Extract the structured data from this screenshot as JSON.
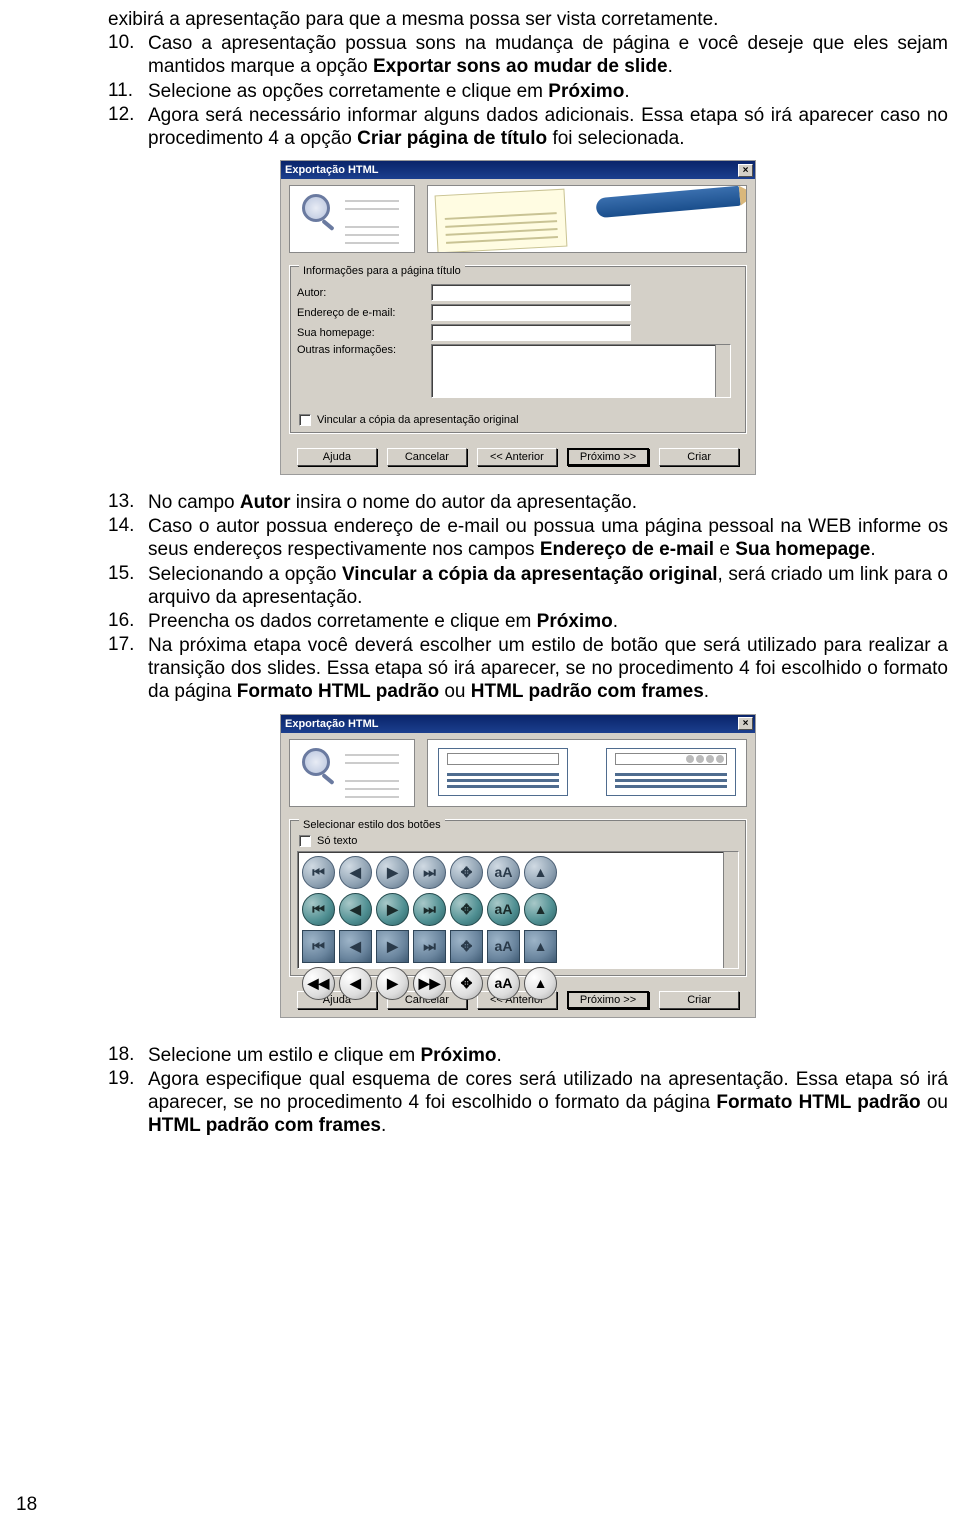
{
  "intro_line": "exibirá a apresentação para que a mesma possa ser vista corretamente.",
  "items_a": [
    {
      "n": "10.",
      "pre": "Caso a apresentação possua sons na mudança de página e você deseje que eles sejam mantidos marque a opção ",
      "b": "Exportar sons ao mudar de slide",
      "post": "."
    },
    {
      "n": "11.",
      "pre": "Selecione as opções corretamente e clique em ",
      "b": "Próximo",
      "post": "."
    },
    {
      "n": "12.",
      "pre": "Agora será necessário informar alguns dados adicionais. Essa etapa só irá aparecer caso no procedimento 4 a opção ",
      "b": "Criar página de título",
      "post": " foi selecionada."
    }
  ],
  "dialog1": {
    "title": "Exportação HTML",
    "close": "×",
    "group": "Informações para a página título",
    "labels": {
      "autor": "Autor:",
      "email": "Endereço de e-mail:",
      "home": "Sua homepage:",
      "other": "Outras informações:"
    },
    "chk": "Vincular a cópia da apresentação original",
    "buttons": {
      "ajuda": "Ajuda",
      "cancelar": "Cancelar",
      "anterior": "<< Anterior",
      "proximo": "Próximo >>",
      "criar": "Criar"
    }
  },
  "items_b": [
    {
      "n": "13.",
      "parts": [
        {
          "t": "No campo "
        },
        {
          "t": "Autor",
          "b": true
        },
        {
          "t": " insira o nome do autor da apresentação."
        }
      ]
    },
    {
      "n": "14.",
      "parts": [
        {
          "t": "Caso o autor possua endereço de e-mail ou possua uma página pessoal na WEB informe os seus endereços respectivamente nos campos "
        },
        {
          "t": "Endereço de e-mail",
          "b": true
        },
        {
          "t": " e "
        },
        {
          "t": "Sua homepage",
          "b": true
        },
        {
          "t": "."
        }
      ]
    },
    {
      "n": "15.",
      "parts": [
        {
          "t": "Selecionando a opção "
        },
        {
          "t": "Vincular a cópia da apresentação original",
          "b": true
        },
        {
          "t": ", será criado um link para o arquivo da apresentação."
        }
      ]
    },
    {
      "n": "16.",
      "parts": [
        {
          "t": "Preencha os dados corretamente e clique em "
        },
        {
          "t": "Próximo",
          "b": true
        },
        {
          "t": "."
        }
      ]
    },
    {
      "n": "17.",
      "parts": [
        {
          "t": "Na próxima etapa você deverá escolher um estilo de botão que será utilizado para realizar a transição dos slides. Essa etapa só irá aparecer, se no procedimento 4 foi escolhido o formato da página "
        },
        {
          "t": "Formato HTML padrão",
          "b": true
        },
        {
          "t": " ou "
        },
        {
          "t": "HTML padrão com frames",
          "b": true
        },
        {
          "t": "."
        }
      ]
    }
  ],
  "dialog2": {
    "title": "Exportação HTML",
    "close": "×",
    "group": "Selecionar estilo dos botões",
    "chk": "Só texto",
    "buttons": {
      "ajuda": "Ajuda",
      "cancelar": "Cancelar",
      "anterior": "<< Anterior",
      "proximo": "Próximo >>",
      "criar": "Criar"
    },
    "glyphs": {
      "first": "⏮",
      "prev": "◀",
      "next": "▶",
      "last": "⏭",
      "move": "✥",
      "aa": "aA",
      "up": "▲",
      "rw": "◀◀",
      "ff": "▶▶"
    }
  },
  "items_c": [
    {
      "n": "18.",
      "parts": [
        {
          "t": "Selecione um estilo e clique em "
        },
        {
          "t": "Próximo",
          "b": true
        },
        {
          "t": "."
        }
      ]
    },
    {
      "n": "19.",
      "parts": [
        {
          "t": "Agora especifique qual esquema de cores será utilizado na apresentação. Essa etapa só irá aparecer, se no procedimento 4 foi escolhido o formato da página "
        },
        {
          "t": "Formato HTML padrão",
          "b": true
        },
        {
          "t": " ou "
        },
        {
          "t": "HTML padrão com frames",
          "b": true
        },
        {
          "t": "."
        }
      ]
    }
  ],
  "page_number": "18"
}
